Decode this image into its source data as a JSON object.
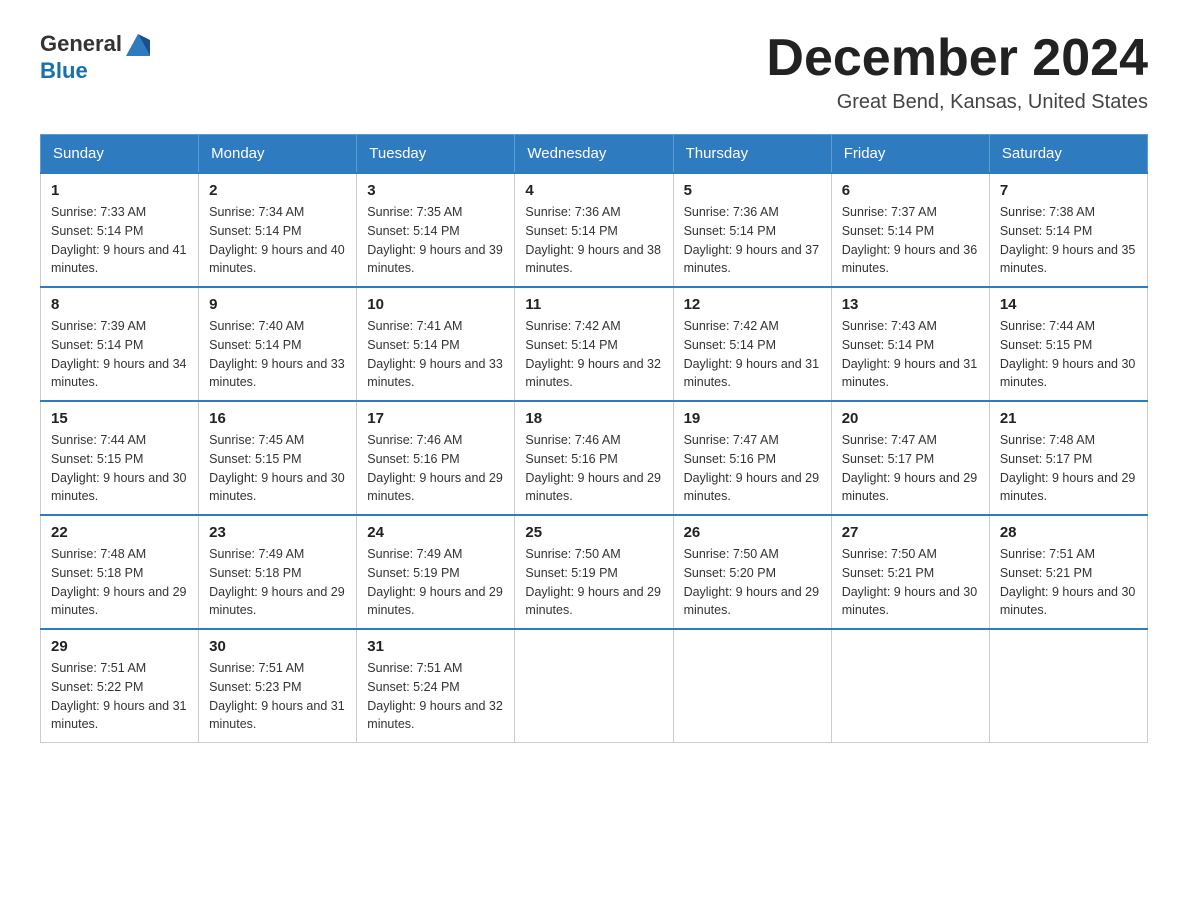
{
  "header": {
    "logo_general": "General",
    "logo_blue": "Blue",
    "month": "December 2024",
    "location": "Great Bend, Kansas, United States"
  },
  "weekdays": [
    "Sunday",
    "Monday",
    "Tuesday",
    "Wednesday",
    "Thursday",
    "Friday",
    "Saturday"
  ],
  "weeks": [
    [
      {
        "day": "1",
        "sunrise": "7:33 AM",
        "sunset": "5:14 PM",
        "daylight": "9 hours and 41 minutes."
      },
      {
        "day": "2",
        "sunrise": "7:34 AM",
        "sunset": "5:14 PM",
        "daylight": "9 hours and 40 minutes."
      },
      {
        "day": "3",
        "sunrise": "7:35 AM",
        "sunset": "5:14 PM",
        "daylight": "9 hours and 39 minutes."
      },
      {
        "day": "4",
        "sunrise": "7:36 AM",
        "sunset": "5:14 PM",
        "daylight": "9 hours and 38 minutes."
      },
      {
        "day": "5",
        "sunrise": "7:36 AM",
        "sunset": "5:14 PM",
        "daylight": "9 hours and 37 minutes."
      },
      {
        "day": "6",
        "sunrise": "7:37 AM",
        "sunset": "5:14 PM",
        "daylight": "9 hours and 36 minutes."
      },
      {
        "day": "7",
        "sunrise": "7:38 AM",
        "sunset": "5:14 PM",
        "daylight": "9 hours and 35 minutes."
      }
    ],
    [
      {
        "day": "8",
        "sunrise": "7:39 AM",
        "sunset": "5:14 PM",
        "daylight": "9 hours and 34 minutes."
      },
      {
        "day": "9",
        "sunrise": "7:40 AM",
        "sunset": "5:14 PM",
        "daylight": "9 hours and 33 minutes."
      },
      {
        "day": "10",
        "sunrise": "7:41 AM",
        "sunset": "5:14 PM",
        "daylight": "9 hours and 33 minutes."
      },
      {
        "day": "11",
        "sunrise": "7:42 AM",
        "sunset": "5:14 PM",
        "daylight": "9 hours and 32 minutes."
      },
      {
        "day": "12",
        "sunrise": "7:42 AM",
        "sunset": "5:14 PM",
        "daylight": "9 hours and 31 minutes."
      },
      {
        "day": "13",
        "sunrise": "7:43 AM",
        "sunset": "5:14 PM",
        "daylight": "9 hours and 31 minutes."
      },
      {
        "day": "14",
        "sunrise": "7:44 AM",
        "sunset": "5:15 PM",
        "daylight": "9 hours and 30 minutes."
      }
    ],
    [
      {
        "day": "15",
        "sunrise": "7:44 AM",
        "sunset": "5:15 PM",
        "daylight": "9 hours and 30 minutes."
      },
      {
        "day": "16",
        "sunrise": "7:45 AM",
        "sunset": "5:15 PM",
        "daylight": "9 hours and 30 minutes."
      },
      {
        "day": "17",
        "sunrise": "7:46 AM",
        "sunset": "5:16 PM",
        "daylight": "9 hours and 29 minutes."
      },
      {
        "day": "18",
        "sunrise": "7:46 AM",
        "sunset": "5:16 PM",
        "daylight": "9 hours and 29 minutes."
      },
      {
        "day": "19",
        "sunrise": "7:47 AM",
        "sunset": "5:16 PM",
        "daylight": "9 hours and 29 minutes."
      },
      {
        "day": "20",
        "sunrise": "7:47 AM",
        "sunset": "5:17 PM",
        "daylight": "9 hours and 29 minutes."
      },
      {
        "day": "21",
        "sunrise": "7:48 AM",
        "sunset": "5:17 PM",
        "daylight": "9 hours and 29 minutes."
      }
    ],
    [
      {
        "day": "22",
        "sunrise": "7:48 AM",
        "sunset": "5:18 PM",
        "daylight": "9 hours and 29 minutes."
      },
      {
        "day": "23",
        "sunrise": "7:49 AM",
        "sunset": "5:18 PM",
        "daylight": "9 hours and 29 minutes."
      },
      {
        "day": "24",
        "sunrise": "7:49 AM",
        "sunset": "5:19 PM",
        "daylight": "9 hours and 29 minutes."
      },
      {
        "day": "25",
        "sunrise": "7:50 AM",
        "sunset": "5:19 PM",
        "daylight": "9 hours and 29 minutes."
      },
      {
        "day": "26",
        "sunrise": "7:50 AM",
        "sunset": "5:20 PM",
        "daylight": "9 hours and 29 minutes."
      },
      {
        "day": "27",
        "sunrise": "7:50 AM",
        "sunset": "5:21 PM",
        "daylight": "9 hours and 30 minutes."
      },
      {
        "day": "28",
        "sunrise": "7:51 AM",
        "sunset": "5:21 PM",
        "daylight": "9 hours and 30 minutes."
      }
    ],
    [
      {
        "day": "29",
        "sunrise": "7:51 AM",
        "sunset": "5:22 PM",
        "daylight": "9 hours and 31 minutes."
      },
      {
        "day": "30",
        "sunrise": "7:51 AM",
        "sunset": "5:23 PM",
        "daylight": "9 hours and 31 minutes."
      },
      {
        "day": "31",
        "sunrise": "7:51 AM",
        "sunset": "5:24 PM",
        "daylight": "9 hours and 32 minutes."
      },
      null,
      null,
      null,
      null
    ]
  ]
}
